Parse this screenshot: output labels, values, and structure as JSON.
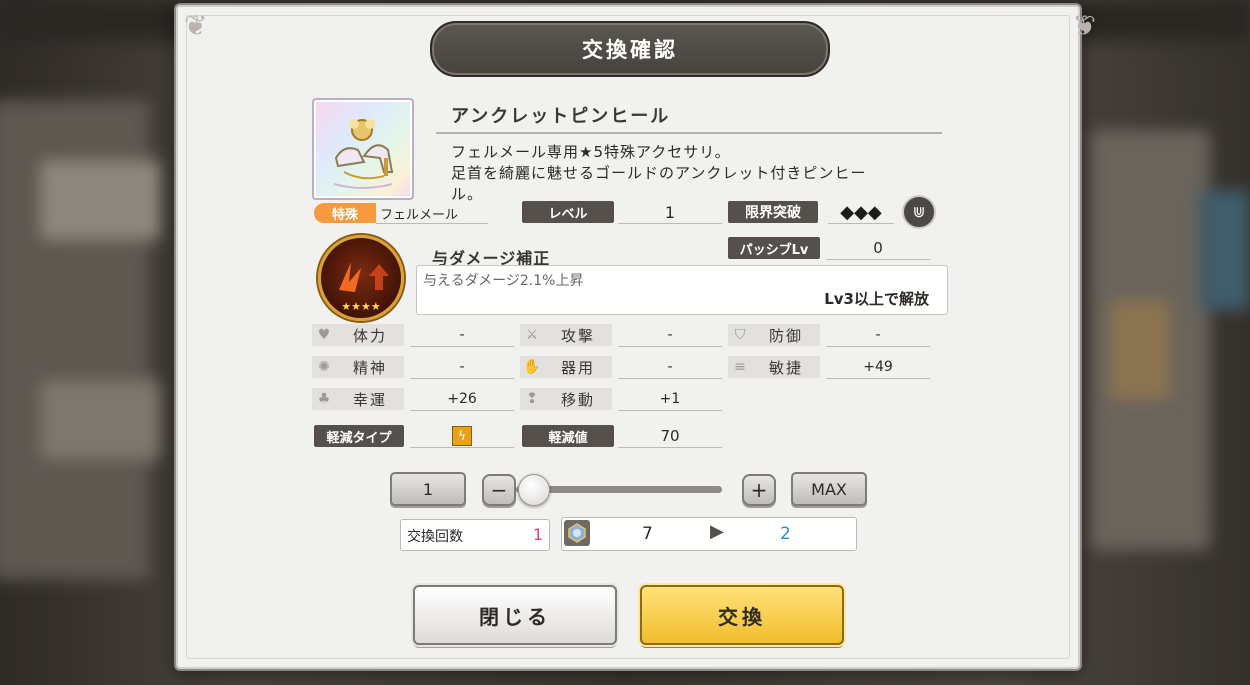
{
  "dialog": {
    "title": "交換確認",
    "item": {
      "name": "アンクレットピンヒール",
      "description_line1": "フェルメール専用★5特殊アクセサリ。",
      "description_line2": "足首を綺麗に魅せるゴールドのアンクレット付きピンヒー",
      "description_line3": "ル。",
      "category_badge": "特殊",
      "owner": "フェルメール",
      "level_label": "レベル",
      "level_value": "1",
      "limit_break_label": "限界突破",
      "limit_break_value": "◆◆◆",
      "passive_label": "パッシブLv",
      "passive_value": "0"
    },
    "skill": {
      "name": "与ダメージ補正",
      "description": "与えるダメージ2.1%上昇",
      "unlock": "Lv3以上で解放",
      "stars": 4
    },
    "stats": [
      {
        "icon": "heart-icon",
        "glyph": "♥",
        "label": "体力",
        "value": "-"
      },
      {
        "icon": "sword-icon",
        "glyph": "⚔",
        "label": "攻撃",
        "value": "-"
      },
      {
        "icon": "shield-icon",
        "glyph": "⛉",
        "label": "防御",
        "value": "-"
      },
      {
        "icon": "spirit-icon",
        "glyph": "✺",
        "label": "精神",
        "value": "-"
      },
      {
        "icon": "hand-icon",
        "glyph": "✋",
        "label": "器用",
        "value": "-"
      },
      {
        "icon": "speed-icon",
        "glyph": "≡",
        "label": "敏捷",
        "value": "+49"
      },
      {
        "icon": "clover-icon",
        "glyph": "♣",
        "label": "幸運",
        "value": "+26"
      },
      {
        "icon": "footprint-icon",
        "glyph": "❢",
        "label": "移動",
        "value": "+1"
      }
    ],
    "mitigation": {
      "type_label": "軽減タイプ",
      "type_icon": "lightning-icon",
      "value_label": "軽減値",
      "value": "70"
    },
    "quantity": {
      "value": "1",
      "minus": "−",
      "plus": "+",
      "max_label": "MAX",
      "slider_fraction": 0
    },
    "exchange": {
      "count_label": "交換回数",
      "count_value": "1",
      "currency_icon": "medal-icon",
      "currency_before": "7",
      "currency_after": "2",
      "accent_red": "#e2456d",
      "accent_blue": "#2a8fdc"
    },
    "buttons": {
      "close": "閉じる",
      "confirm": "交換"
    }
  }
}
